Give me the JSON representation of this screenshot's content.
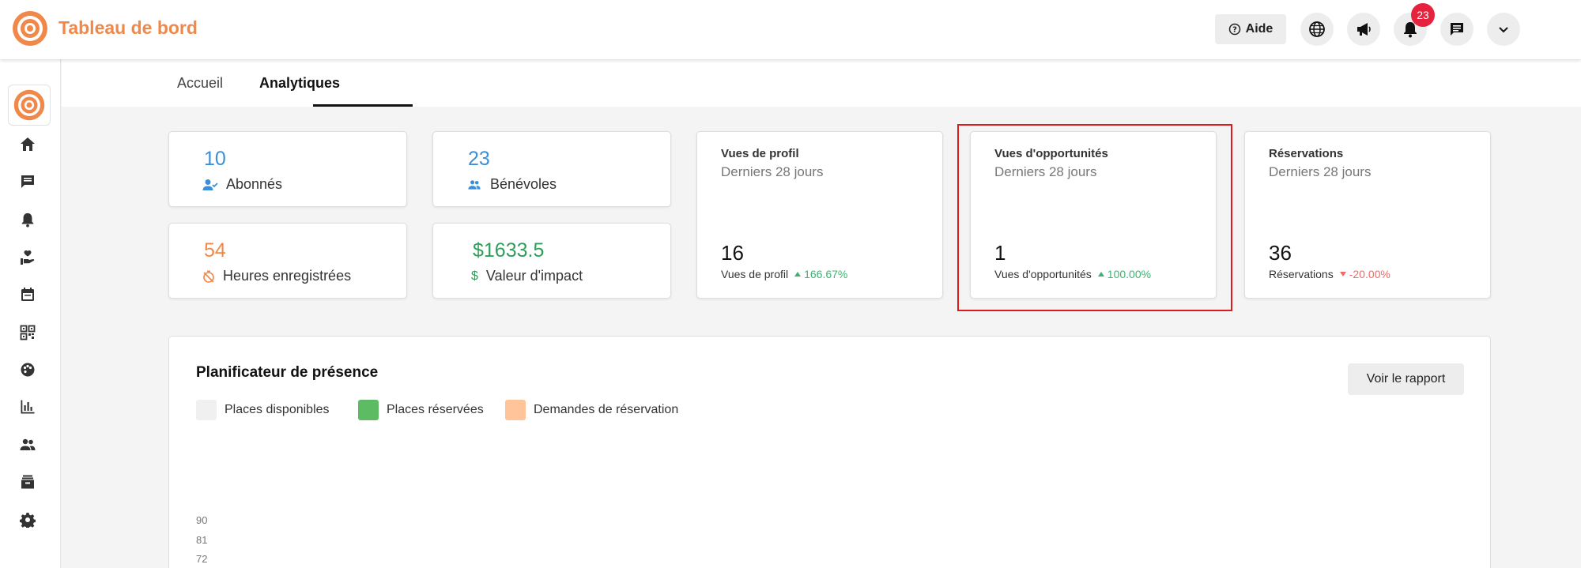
{
  "app": {
    "title": "Tableau de bord"
  },
  "topbar": {
    "help_label": "Aide",
    "notification_count": "23",
    "icons": [
      "help-icon",
      "globe-icon",
      "megaphone-icon",
      "bell-icon",
      "chat-icon",
      "chevron-down-icon"
    ]
  },
  "sidebar": {
    "icons": [
      "home-icon",
      "chat-icon",
      "bell-icon",
      "hand-heart-icon",
      "calendar-icon",
      "qr-code-icon",
      "palette-icon",
      "bar-chart-icon",
      "people-icon",
      "inbox-icon",
      "gear-icon"
    ]
  },
  "tabs": [
    {
      "label": "Accueil",
      "active": false
    },
    {
      "label": "Analytiques",
      "active": true
    }
  ],
  "stats": {
    "subscribers": {
      "value": "10",
      "label": "Abonnés",
      "color": "#3a8fd8"
    },
    "volunteers": {
      "value": "23",
      "label": "Bénévoles",
      "color": "#3a8fd8"
    },
    "hours": {
      "value": "54",
      "label": "Heures enregistrées",
      "color": "#f0884a"
    },
    "impact": {
      "value": "$1633.5",
      "label": "Valeur d'impact",
      "color": "#2e9e5a"
    }
  },
  "metrics": {
    "profile_views": {
      "title": "Vues de profil",
      "subtitle": "Derniers 28 jours",
      "value": "16",
      "label": "Vues de profil",
      "change": "166.67%",
      "trend": "up"
    },
    "opportunity_views": {
      "title": "Vues d'opportunités",
      "subtitle": "Derniers 28 jours",
      "value": "1",
      "label": "Vues d'opportunités",
      "change": "100.00%",
      "trend": "up"
    },
    "reservations": {
      "title": "Réservations",
      "subtitle": "Derniers 28 jours",
      "value": "36",
      "label": "Réservations",
      "change": "-20.00%",
      "trend": "down"
    }
  },
  "planner": {
    "title": "Planificateur de présence",
    "report_button": "Voir le rapport",
    "legend": [
      {
        "label": "Places disponibles",
        "color": "#f0f0f0"
      },
      {
        "label": "Places réservées",
        "color": "#5dbb63"
      },
      {
        "label": "Demandes de réservation",
        "color": "#ffc49a"
      }
    ],
    "y_ticks": [
      "90",
      "81",
      "72"
    ]
  },
  "colors": {
    "brand": "#f0884a",
    "badge": "#e5233f",
    "highlight": "#e01b1b"
  }
}
